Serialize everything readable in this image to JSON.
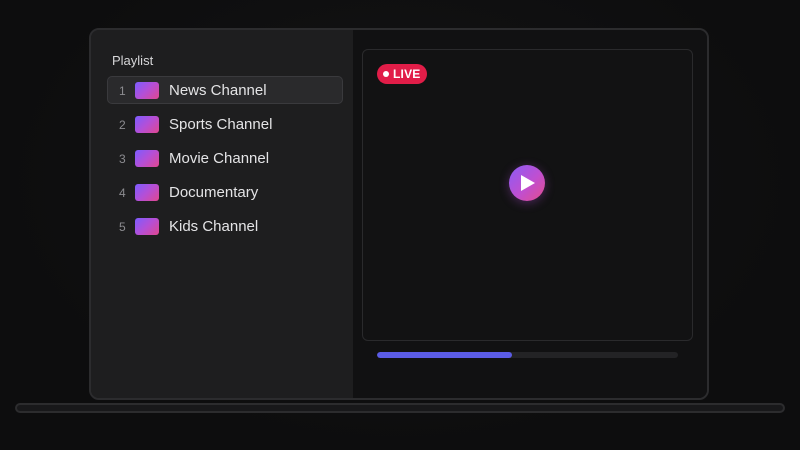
{
  "playlist": {
    "title": "Playlist",
    "items": [
      {
        "number": "1",
        "label": "News Channel",
        "active": true
      },
      {
        "number": "2",
        "label": "Sports Channel",
        "active": false
      },
      {
        "number": "3",
        "label": "Movie Channel",
        "active": false
      },
      {
        "number": "4",
        "label": "Documentary",
        "active": false
      },
      {
        "number": "5",
        "label": "Kids Channel",
        "active": false
      }
    ]
  },
  "player": {
    "live_label": "LIVE",
    "progress_percent": 45
  },
  "colors": {
    "live_badge": "#e11d48",
    "progress_fill": "#5b5ce6",
    "thumbnail_gradient_start": "#7c5cff",
    "thumbnail_gradient_end": "#e0478f"
  },
  "icons": {
    "play": "play-icon",
    "live_dot": "live-dot-icon"
  }
}
